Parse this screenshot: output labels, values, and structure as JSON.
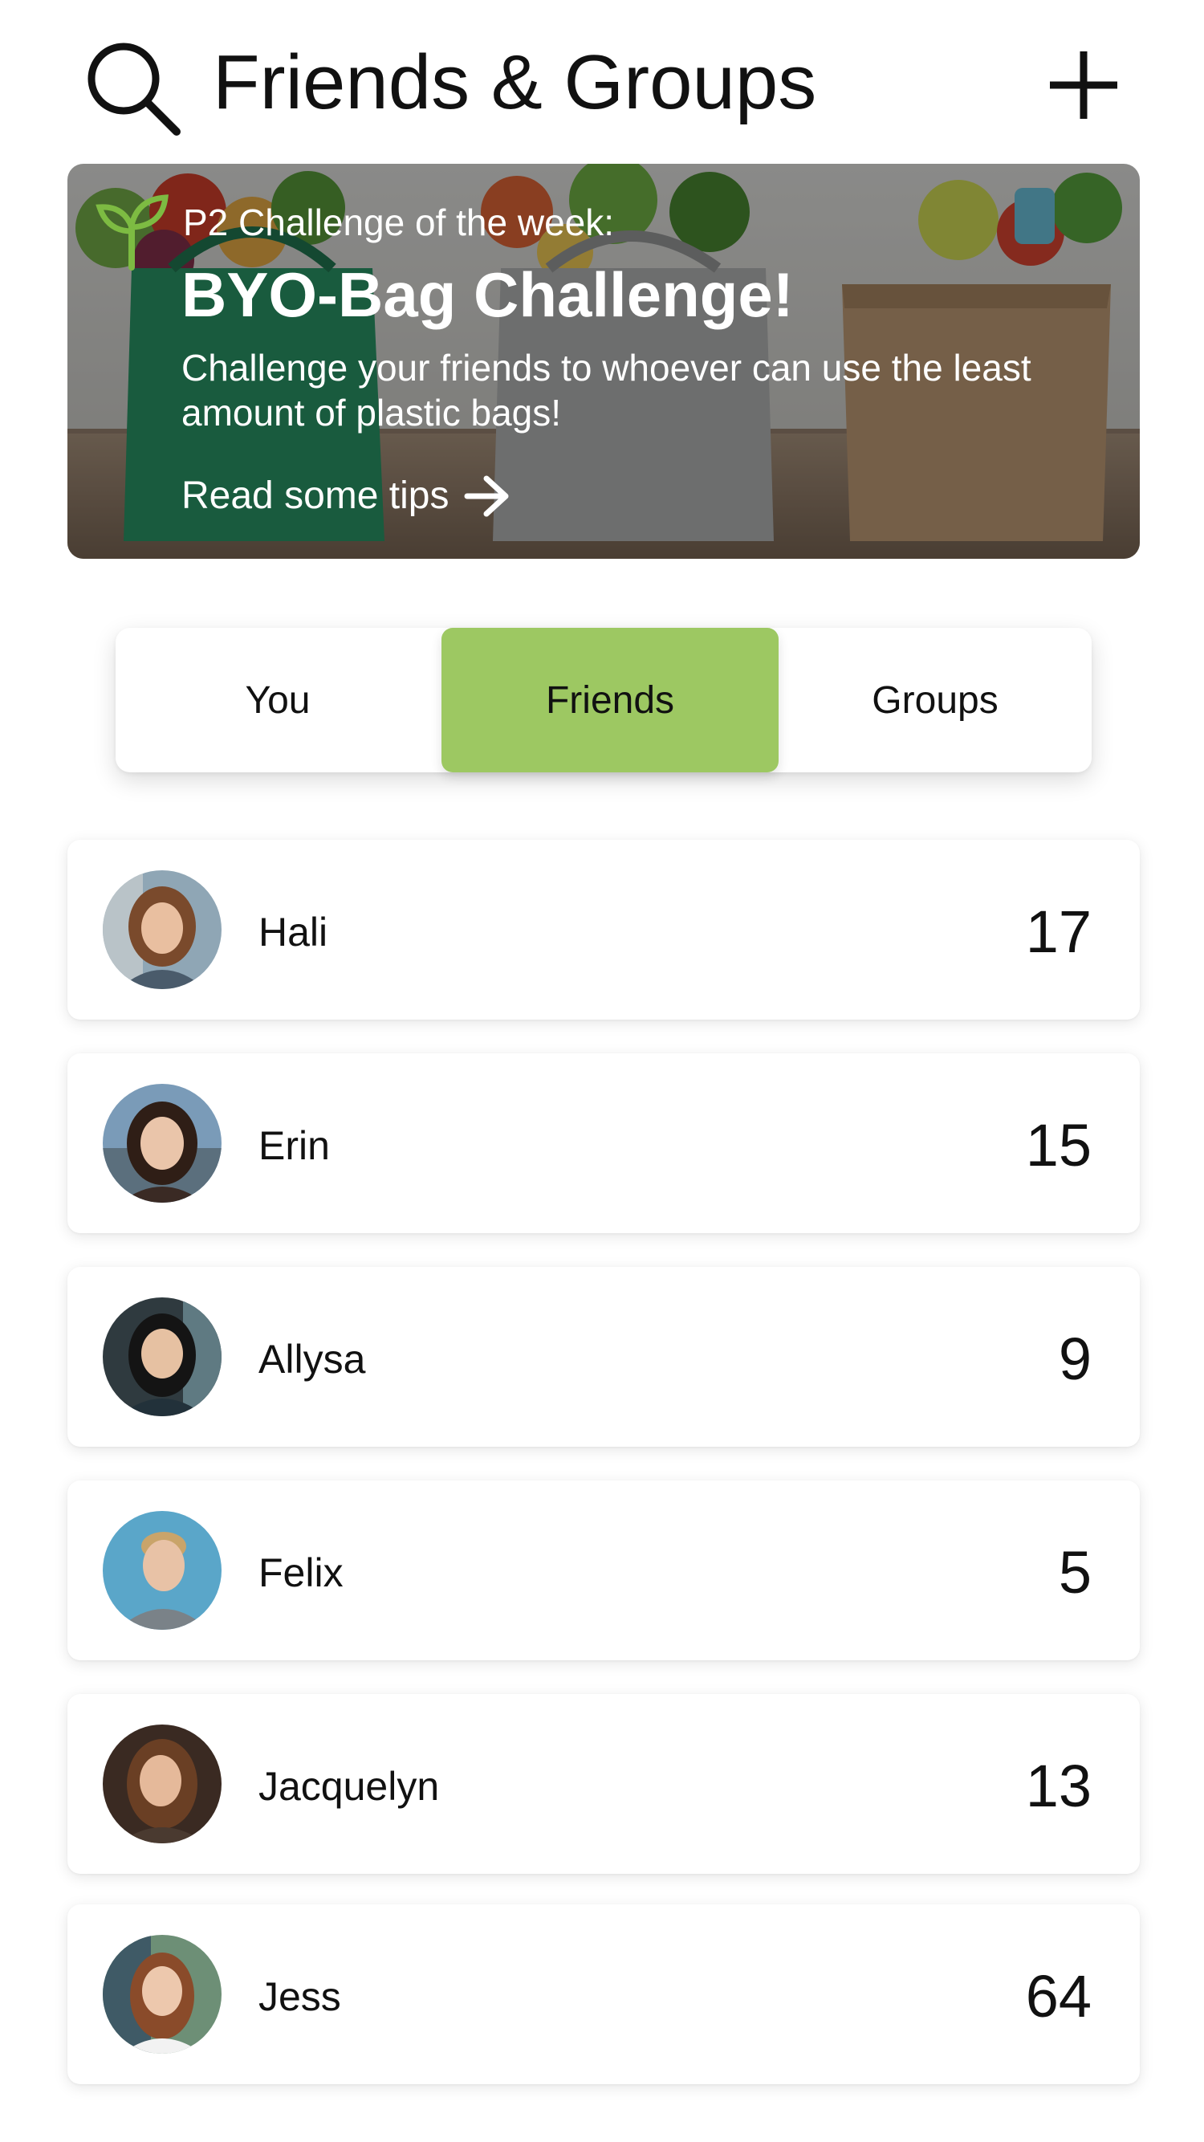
{
  "header": {
    "title": "Friends & Groups",
    "search_icon": "search-icon",
    "add_icon": "plus-icon"
  },
  "banner": {
    "eyebrow": "P2 Challenge of the week:",
    "title": "BYO-Bag Challenge!",
    "description": "Challenge your friends to whoever can use the least amount of plastic bags!",
    "link_label": "Read some tips",
    "link_icon": "arrow-right-icon",
    "badge_icon": "sprout-icon"
  },
  "tabs": {
    "items": [
      {
        "label": "You",
        "selected": false
      },
      {
        "label": "Friends",
        "selected": true
      },
      {
        "label": "Groups",
        "selected": false
      }
    ]
  },
  "friends": [
    {
      "name": "Hali",
      "score": "17"
    },
    {
      "name": "Erin",
      "score": "15"
    },
    {
      "name": "Allysa",
      "score": "9"
    },
    {
      "name": "Felix",
      "score": "5"
    },
    {
      "name": "Jacquelyn",
      "score": "13"
    },
    {
      "name": "Jess",
      "score": "64"
    }
  ],
  "colors": {
    "accent": "#9dc862",
    "sprout": "#7dbb42",
    "text": "#111111",
    "card": "#ffffff"
  }
}
